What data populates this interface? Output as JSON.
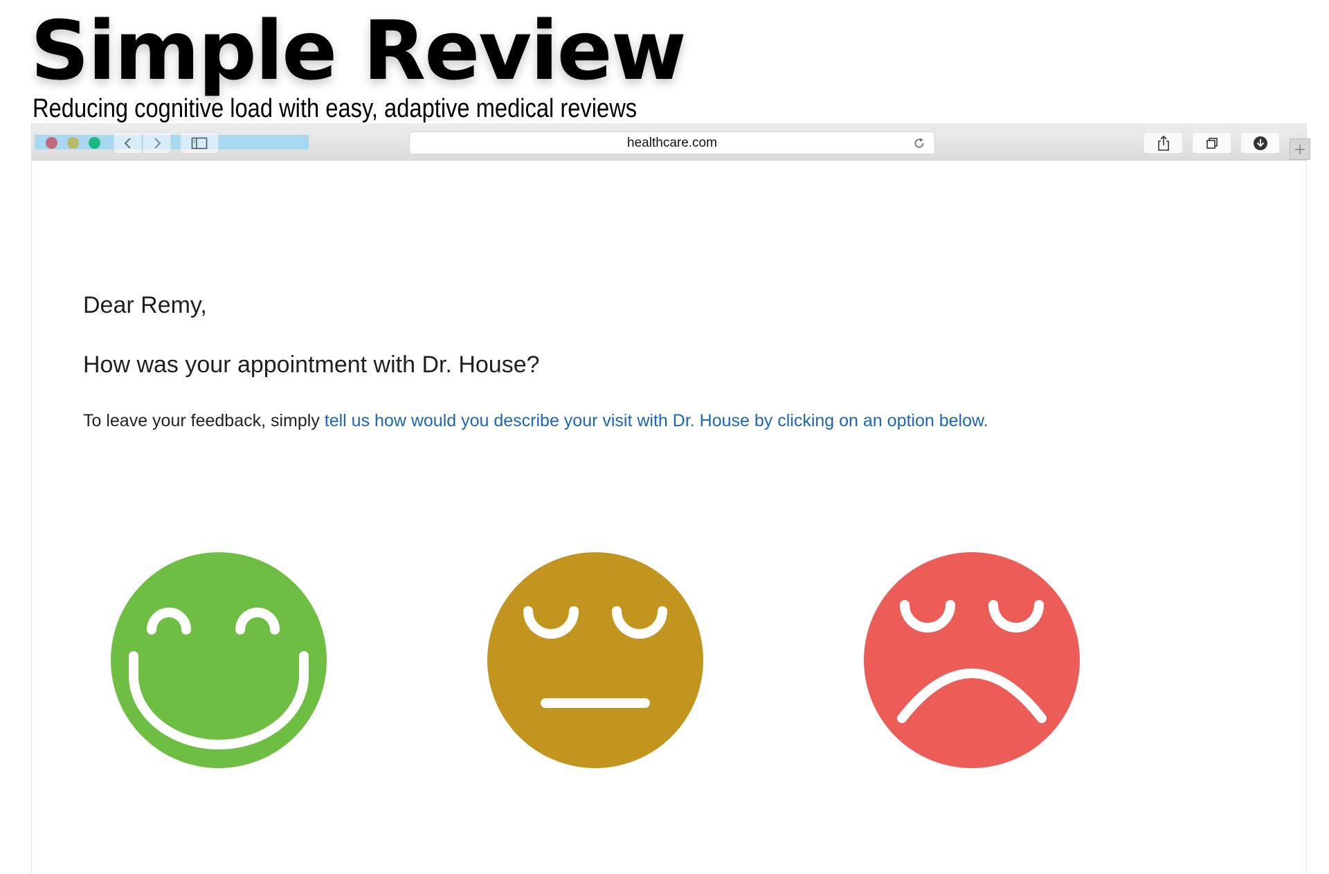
{
  "hero": {
    "title": "Simple Review",
    "subtitle": "Reducing cognitive load with easy, adaptive medical reviews"
  },
  "browser": {
    "url": "healthcare.com",
    "toolbar_icons": [
      "close-icon",
      "minimize-icon",
      "zoom-icon",
      "chevron-left-icon",
      "chevron-right-icon",
      "sidebar-icon",
      "reload-icon",
      "share-icon",
      "tabs-icon",
      "download-icon",
      "plus-icon"
    ]
  },
  "page": {
    "greeting": "Dear Remy,",
    "question": "How was your appointment with Dr. House?",
    "instructions_prefix": "To leave your feedback, simply ",
    "instructions_link": "tell us how would you describe your visit with Dr. House by clicking on an option below."
  },
  "faces": [
    {
      "mood": "happy",
      "color": "#6fbe44"
    },
    {
      "mood": "neutral",
      "color": "#c2961e"
    },
    {
      "mood": "sad",
      "color": "#ec5d57"
    }
  ],
  "colors": {
    "link": "#1b66b5",
    "toolbar_highlight": "#a7d8ef",
    "traffic_red": "#c26b7d",
    "traffic_yellow": "#b9b96a",
    "traffic_green": "#18b880"
  }
}
